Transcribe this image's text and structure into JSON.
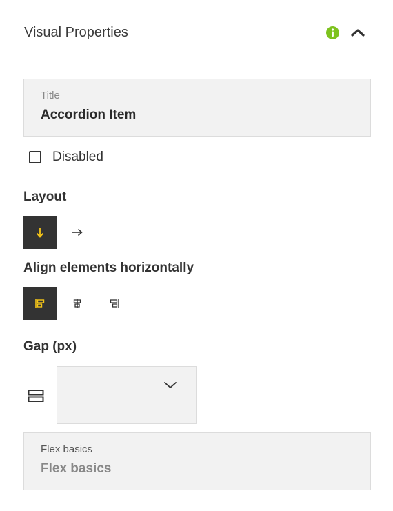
{
  "panel": {
    "title": "Visual Properties",
    "icons": {
      "info": "info-icon",
      "collapse": "chevron-up-icon"
    },
    "accent_color": "#7dc21e"
  },
  "title_field": {
    "label": "Title",
    "value": "Accordion Item"
  },
  "disabled_checkbox": {
    "label": "Disabled",
    "checked": false
  },
  "layout": {
    "heading": "Layout",
    "options": [
      {
        "icon": "arrow-down-icon",
        "selected": true
      },
      {
        "icon": "arrow-right-icon",
        "selected": false
      }
    ]
  },
  "align": {
    "heading": "Align elements horizontally",
    "options": [
      {
        "icon": "align-left-icon",
        "selected": true
      },
      {
        "icon": "align-center-icon",
        "selected": false
      },
      {
        "icon": "align-right-icon",
        "selected": false
      }
    ]
  },
  "gap": {
    "heading": "Gap (px)",
    "icon": "gap-rows-icon",
    "value": ""
  },
  "flex_basics": {
    "label": "Flex basics",
    "placeholder": "Flex basics"
  },
  "colors": {
    "active_bg": "#333333",
    "active_fg": "#f5c518",
    "field_bg": "#f2f2f2"
  }
}
